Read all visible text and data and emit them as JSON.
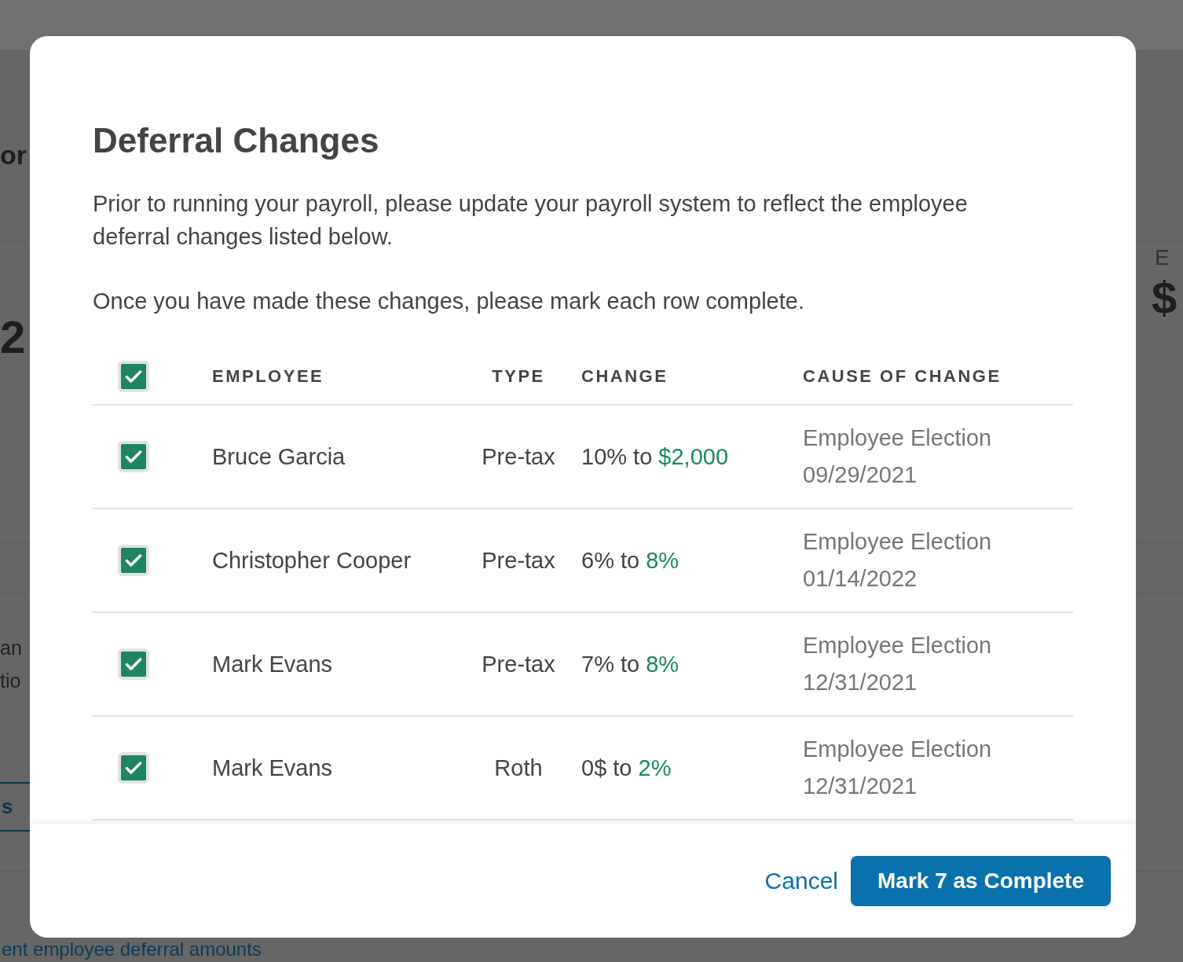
{
  "background_page": [
    {
      "text": "or",
      "kind": "heading"
    },
    {
      "text": "2",
      "kind": "heading"
    },
    {
      "text": "an",
      "kind": "body"
    },
    {
      "text": "tio",
      "kind": "body"
    },
    {
      "text": "s",
      "kind": "button"
    },
    {
      "text": "ent employee deferral amounts",
      "kind": "link"
    },
    {
      "text": "E",
      "kind": "label"
    },
    {
      "text": "$",
      "kind": "heading"
    }
  ],
  "dialog": {
    "title": "Deferral Changes",
    "paragraphs": [
      "Prior to running your payroll, please update your payroll system to reflect the employee deferral changes listed below.",
      "Once you have made these changes, please mark each row complete."
    ],
    "table": {
      "select_all_checked": true,
      "columns": [
        "EMPLOYEE",
        "TYPE",
        "CHANGE",
        "CAUSE OF CHANGE"
      ],
      "rows": [
        {
          "checked": true,
          "employee": "Bruce Garcia",
          "type": "Pre-tax",
          "change_from": "10% to",
          "change_to": "$2,000",
          "cause": "Employee Election",
          "date": "09/29/2021"
        },
        {
          "checked": true,
          "employee": "Christopher Cooper",
          "type": "Pre-tax",
          "change_from": "6% to",
          "change_to": "8%",
          "cause": "Employee Election",
          "date": "01/14/2022"
        },
        {
          "checked": true,
          "employee": "Mark Evans",
          "type": "Pre-tax",
          "change_from": "7% to",
          "change_to": "8%",
          "cause": "Employee Election",
          "date": "12/31/2021"
        },
        {
          "checked": true,
          "employee": "Mark Evans",
          "type": "Roth",
          "change_from": "0$ to",
          "change_to": "2%",
          "cause": "Employee Election",
          "date": "12/31/2021"
        }
      ]
    },
    "cancel_label": "Cancel",
    "confirm_label": "Mark 7 as Complete"
  }
}
